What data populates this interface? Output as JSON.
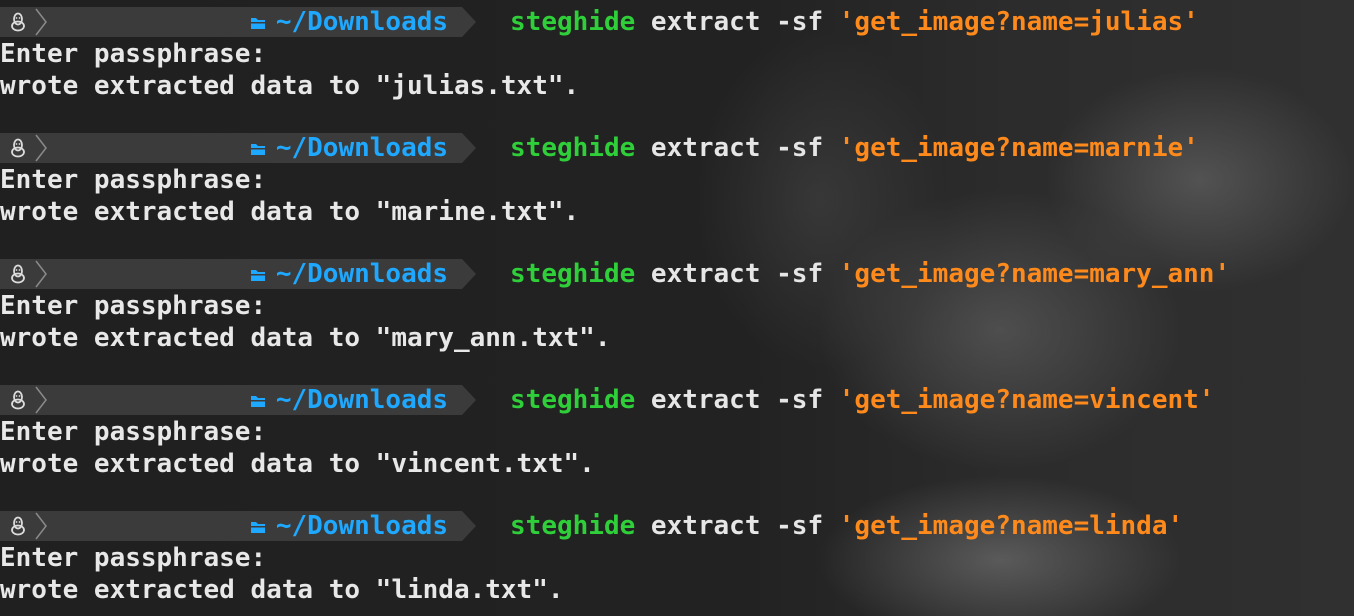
{
  "prompt": {
    "os_icon": "linux-tux-icon",
    "folder_icon": "folder-icon",
    "path": "~/Downloads"
  },
  "blocks": [
    {
      "command": "steghide",
      "args": " extract -sf ",
      "string": "'get_image?name=julias'",
      "output1": "Enter passphrase:",
      "output2": "wrote extracted data to \"julias.txt\"."
    },
    {
      "command": "steghide",
      "args": " extract -sf ",
      "string": "'get_image?name=marnie'",
      "output1": "Enter passphrase:",
      "output2": "wrote extracted data to \"marine.txt\"."
    },
    {
      "command": "steghide",
      "args": " extract -sf ",
      "string": "'get_image?name=mary_ann'",
      "output1": "Enter passphrase:",
      "output2": "wrote extracted data to \"mary_ann.txt\"."
    },
    {
      "command": "steghide",
      "args": " extract -sf ",
      "string": "'get_image?name=vincent'",
      "output1": "Enter passphrase:",
      "output2": "wrote extracted data to \"vincent.txt\"."
    },
    {
      "command": "steghide",
      "args": " extract -sf ",
      "string": "'get_image?name=linda'",
      "output1": "Enter passphrase:",
      "output2": "wrote extracted data to \"linda.txt\"."
    }
  ],
  "colors": {
    "background": "#1f1f1f",
    "prompt_segment": "#3b3b3b",
    "path": "#1ea8ff",
    "command": "#2fcf3a",
    "string": "#ff8a1c",
    "text": "#e6e6e6"
  }
}
